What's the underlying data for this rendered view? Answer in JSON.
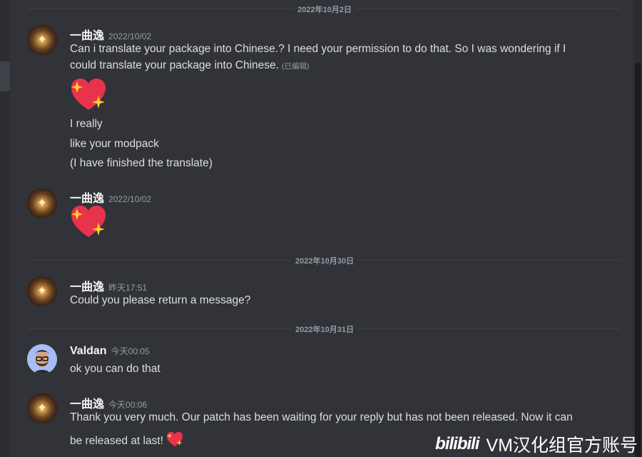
{
  "dividers": [
    "2022年10月2日",
    "2022年10月30日",
    "2022年10月31日"
  ],
  "messages": [
    {
      "author": "一曲逸",
      "time": "2022/10/02",
      "lines": [
        "Can i translate your package into Chinese.?  I need your permission to do that. So I was wondering if I",
        "could translate your package into Chinese."
      ],
      "edited": "(已编辑)",
      "emoji": "sparkling-heart",
      "extra_lines": [
        "I really",
        "like your modpack",
        "(I have finished the translate)"
      ]
    },
    {
      "author": "一曲逸",
      "time": "2022/10/02",
      "emoji": "sparkling-heart"
    },
    {
      "author": "一曲逸",
      "time": "昨天17:51",
      "lines": [
        "Could you please return a message?"
      ]
    },
    {
      "author": "Valdan",
      "time": "今天00:05",
      "lines": [
        "ok you can do that"
      ]
    },
    {
      "author": "一曲逸",
      "time": "今天00:06",
      "lines": [
        "Thank you very much. Our patch has been waiting for your reply but has not been released. Now it can",
        "be released at last!"
      ],
      "emoji": "sparkling-heart"
    }
  ],
  "watermark": {
    "logo": "bilibili",
    "text": "VM汉化组官方账号"
  }
}
